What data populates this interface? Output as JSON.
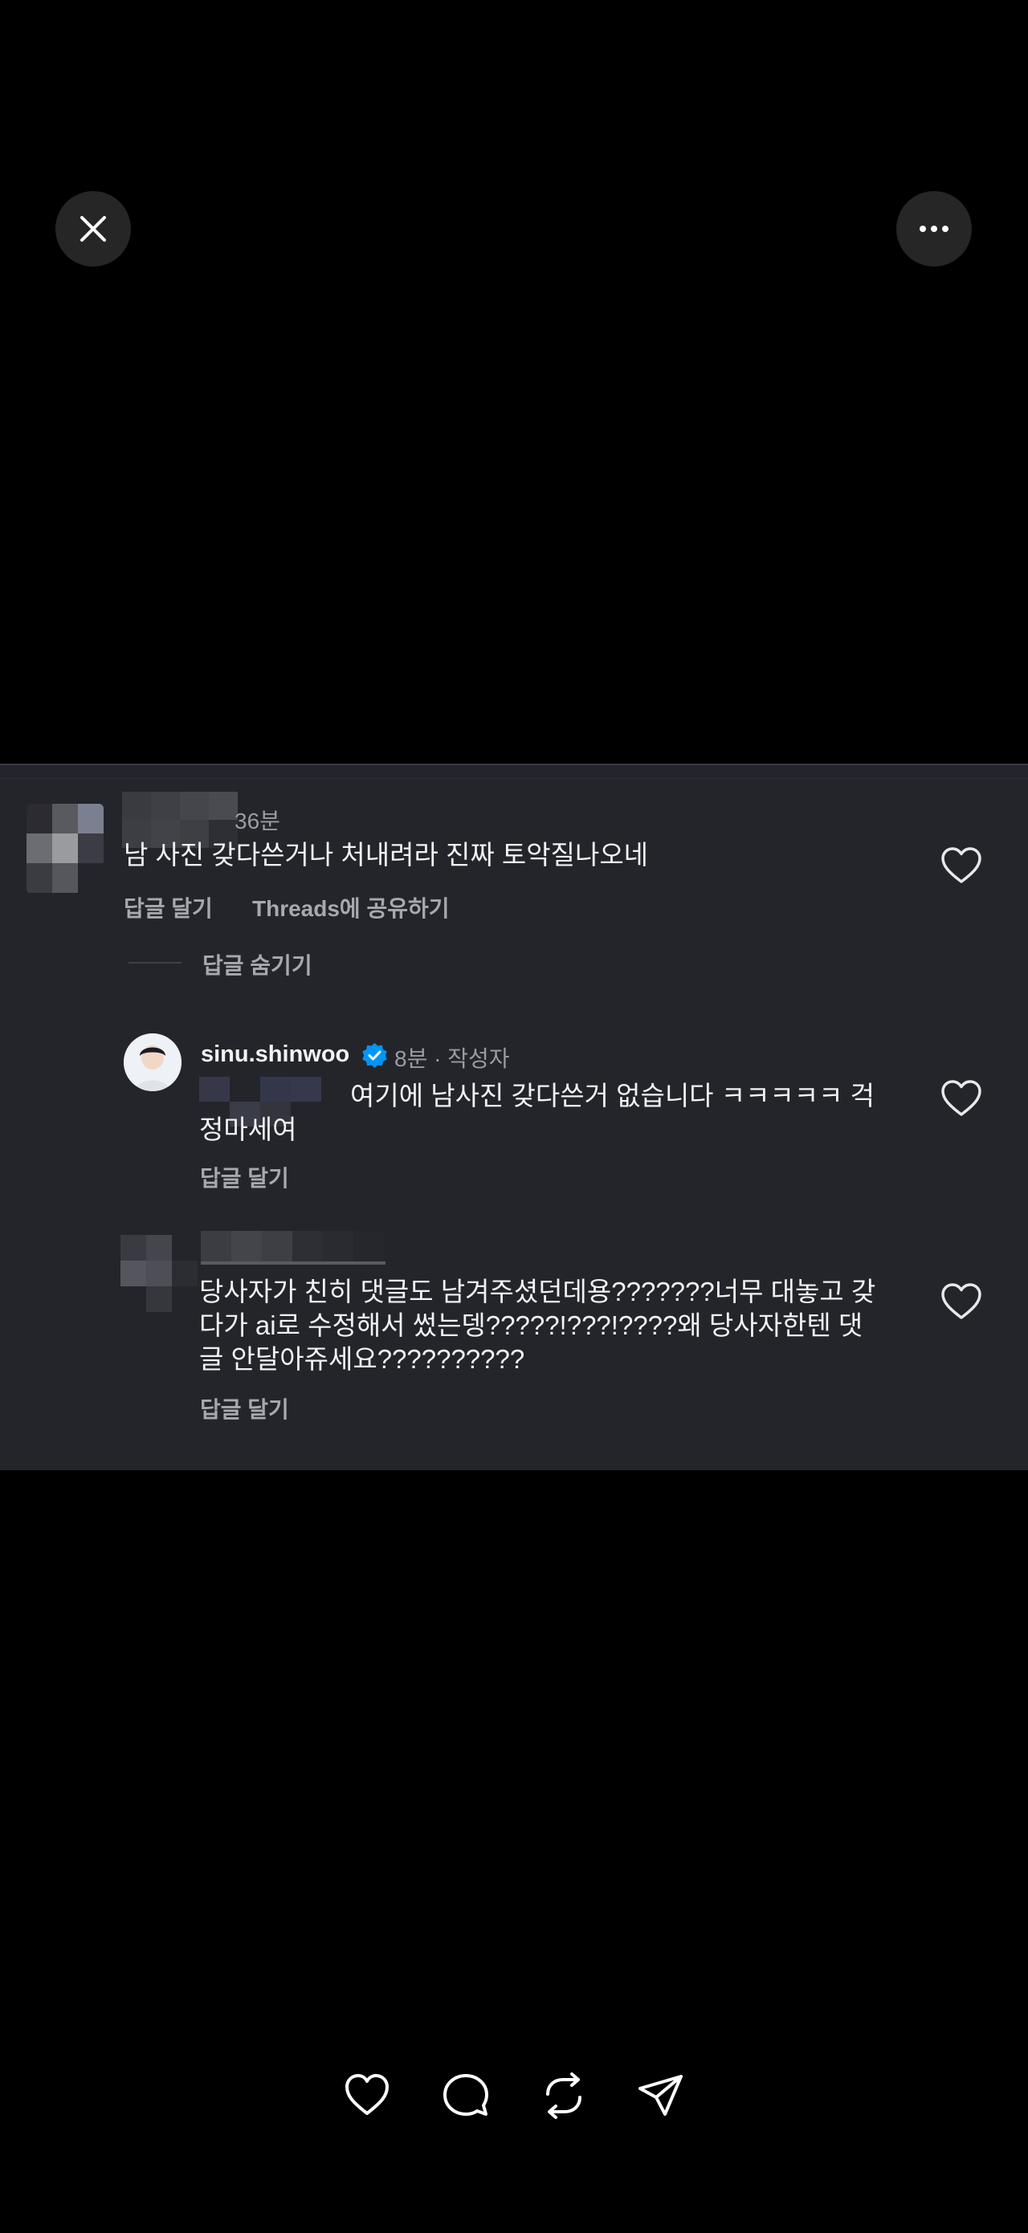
{
  "top_controls": {
    "close_icon": "close-icon",
    "more_icon": "more-horizontal-icon"
  },
  "comments": [
    {
      "time": "36분",
      "text": "남 사진 갖다쓴거나 처내려라 진짜 토악질나오네",
      "reply_label": "답글 달기",
      "share_label": "Threads에 공유하기",
      "hide_replies_label": "답글 숨기기"
    },
    {
      "username": "sinu.shinwoo",
      "verified_icon": "verified-badge-icon",
      "meta": "8분 · 작성자",
      "text_line1": "여기에 남사진 갖다쓴거 없습니다 ㅋㅋㅋㅋㅋ 걱",
      "text_line2": "정마세여",
      "reply_label": "답글 달기"
    },
    {
      "text_lines": [
        "당사자가 친히 댓글도 남겨주셨던데용???????너무 대놓고 갖",
        "다가 ai로 수정해서 썼는뎅?????!???!????왜 당사자한텐 댓",
        "글 안달아쥬세요??????????"
      ],
      "reply_label": "답글 달기"
    }
  ],
  "bottom_actions": [
    "heart-icon",
    "comment-icon",
    "repost-icon",
    "send-icon"
  ],
  "colors": {
    "background": "#000000",
    "panel": "#24252b",
    "verified": "#0095f6",
    "secondary_text": "#9a9ca3"
  }
}
